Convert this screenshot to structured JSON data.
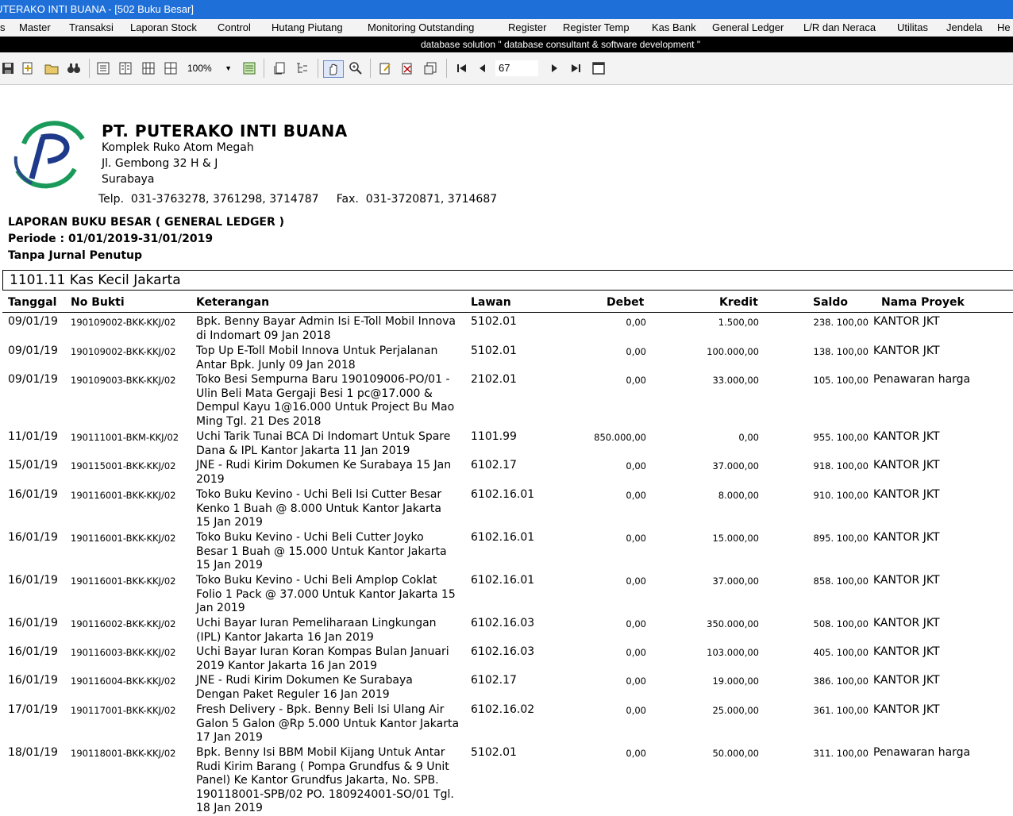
{
  "window": {
    "title": "UTERAKO INTI BUANA - [502 Buku Besar]"
  },
  "menu": [
    "s",
    "Master",
    "Transaksi",
    "Laporan Stock",
    "Control",
    "Hutang Piutang",
    "Monitoring Outstanding",
    "Register",
    "Register Temp",
    "Kas Bank",
    "General Ledger",
    "L/R dan Neraca",
    "Utilitas",
    "Jendela",
    "He"
  ],
  "banner": "database solution  \" database consultant & software development \"",
  "toolbar": {
    "zoom": "100%",
    "page": "67"
  },
  "company": {
    "name": "PT. PUTERAKO INTI BUANA",
    "address": [
      "Komplek Ruko Atom Megah",
      "Jl. Gembong 32 H & J",
      "Surabaya"
    ],
    "phone": "Telp.  031-3763278, 3761298, 3714787     Fax.  031-3720871, 3714687"
  },
  "report": {
    "title": "LAPORAN BUKU BESAR ( GENERAL LEDGER )",
    "period": "Periode : 01/01/2019-31/01/2019",
    "note": "Tanpa Jurnal Penutup",
    "account": "1101.11 Kas Kecil Jakarta"
  },
  "columns": {
    "tanggal": "Tanggal",
    "no_bukti": "No Bukti",
    "keterangan": "Keterangan",
    "lawan": "Lawan",
    "debet": "Debet",
    "kredit": "Kredit",
    "saldo": "Saldo",
    "proyek": "Nama Proyek"
  },
  "rows": [
    {
      "tanggal": "09/01/19",
      "no_bukti": "190109002-BKK-KKJ/02",
      "keterangan": [
        "Bpk. Benny Bayar Admin Isi E-Toll Mobil Innova",
        "di Indomart 09 Jan 2018"
      ],
      "lawan": "5102.01",
      "debet": "0,00",
      "kredit": "1.500,00",
      "saldo": "238. 100,00",
      "proyek": "KANTOR JKT"
    },
    {
      "tanggal": "09/01/19",
      "no_bukti": "190109002-BKK-KKJ/02",
      "keterangan": [
        "Top Up E-Toll Mobil Innova Untuk Perjalanan",
        "Antar Bpk. Junly 09 Jan 2018"
      ],
      "lawan": "5102.01",
      "debet": "0,00",
      "kredit": "100.000,00",
      "saldo": "138. 100,00",
      "proyek": "KANTOR JKT"
    },
    {
      "tanggal": "09/01/19",
      "no_bukti": "190109003-BKK-KKJ/02",
      "keterangan": [
        "Toko Besi Sempurna Baru 190109006-PO/01 -",
        "Ulin Beli Mata Gergaji Besi 1 pc@17.000 &",
        "Dempul Kayu 1@16.000 Untuk Project Bu Mao",
        "Ming Tgl. 21 Des 2018"
      ],
      "lawan": "2102.01",
      "debet": "0,00",
      "kredit": "33.000,00",
      "saldo": "105. 100,00",
      "proyek": "Penawaran harga"
    },
    {
      "tanggal": "11/01/19",
      "no_bukti": "190111001-BKM-KKJ/02",
      "keterangan": [
        "Uchi Tarik Tunai BCA Di Indomart Untuk Spare",
        "Dana & IPL Kantor Jakarta 11 Jan 2019"
      ],
      "lawan": "1101.99",
      "debet": "850.000,00",
      "kredit": "0,00",
      "saldo": "955. 100,00",
      "proyek": "KANTOR JKT"
    },
    {
      "tanggal": "15/01/19",
      "no_bukti": "190115001-BKK-KKJ/02",
      "keterangan": [
        "JNE - Rudi Kirim Dokumen Ke Surabaya 15 Jan",
        "2019"
      ],
      "lawan": "6102.17",
      "debet": "0,00",
      "kredit": "37.000,00",
      "saldo": "918. 100,00",
      "proyek": "KANTOR JKT"
    },
    {
      "tanggal": "16/01/19",
      "no_bukti": "190116001-BKK-KKJ/02",
      "keterangan": [
        "Toko Buku Kevino - Uchi Beli Isi Cutter Besar",
        "Kenko 1 Buah @ 8.000 Untuk Kantor Jakarta",
        "15 Jan 2019"
      ],
      "lawan": "6102.16.01",
      "debet": "0,00",
      "kredit": "8.000,00",
      "saldo": "910. 100,00",
      "proyek": "KANTOR JKT"
    },
    {
      "tanggal": "16/01/19",
      "no_bukti": "190116001-BKK-KKJ/02",
      "keterangan": [
        "Toko Buku Kevino - Uchi Beli Cutter Joyko",
        "Besar 1 Buah @ 15.000 Untuk Kantor Jakarta",
        "15 Jan 2019"
      ],
      "lawan": "6102.16.01",
      "debet": "0,00",
      "kredit": "15.000,00",
      "saldo": "895. 100,00",
      "proyek": "KANTOR JKT"
    },
    {
      "tanggal": "16/01/19",
      "no_bukti": "190116001-BKK-KKJ/02",
      "keterangan": [
        "Toko Buku Kevino - Uchi Beli Amplop Coklat",
        "Folio 1 Pack @ 37.000 Untuk Kantor Jakarta 15",
        "Jan 2019"
      ],
      "lawan": "6102.16.01",
      "debet": "0,00",
      "kredit": "37.000,00",
      "saldo": "858. 100,00",
      "proyek": "KANTOR JKT"
    },
    {
      "tanggal": "16/01/19",
      "no_bukti": "190116002-BKK-KKJ/02",
      "keterangan": [
        "Uchi Bayar Iuran Pemeliharaan Lingkungan",
        "(IPL) Kantor Jakarta 16 Jan 2019"
      ],
      "lawan": "6102.16.03",
      "debet": "0,00",
      "kredit": "350.000,00",
      "saldo": "508. 100,00",
      "proyek": "KANTOR JKT"
    },
    {
      "tanggal": "16/01/19",
      "no_bukti": "190116003-BKK-KKJ/02",
      "keterangan": [
        "Uchi Bayar Iuran Koran Kompas Bulan Januari",
        "2019 Kantor Jakarta 16 Jan 2019"
      ],
      "lawan": "6102.16.03",
      "debet": "0,00",
      "kredit": "103.000,00",
      "saldo": "405. 100,00",
      "proyek": "KANTOR JKT"
    },
    {
      "tanggal": "16/01/19",
      "no_bukti": "190116004-BKK-KKJ/02",
      "keterangan": [
        "JNE - Rudi Kirim Dokumen Ke Surabaya",
        "Dengan Paket Reguler 16 Jan 2019"
      ],
      "lawan": "6102.17",
      "debet": "0,00",
      "kredit": "19.000,00",
      "saldo": "386. 100,00",
      "proyek": "KANTOR JKT"
    },
    {
      "tanggal": "17/01/19",
      "no_bukti": "190117001-BKK-KKJ/02",
      "keterangan": [
        "Fresh Delivery - Bpk. Benny Beli Isi Ulang Air",
        "Galon 5 Galon @Rp 5.000 Untuk Kantor Jakarta",
        "17 Jan 2019"
      ],
      "lawan": "6102.16.02",
      "debet": "0,00",
      "kredit": "25.000,00",
      "saldo": "361. 100,00",
      "proyek": "KANTOR JKT"
    },
    {
      "tanggal": "18/01/19",
      "no_bukti": "190118001-BKK-KKJ/02",
      "keterangan": [
        "Bpk. Benny Isi BBM Mobil Kijang Untuk Antar",
        "Rudi Kirim Barang ( Pompa Grundfus & 9 Unit",
        "Panel) Ke Kantor Grundfus Jakarta, No. SPB.",
        "190118001-SPB/02  PO. 180924001-SO/01 Tgl.",
        "18 Jan 2019"
      ],
      "lawan": "5102.01",
      "debet": "0,00",
      "kredit": "50.000,00",
      "saldo": "311. 100,00",
      "proyek": "Penawaran harga"
    }
  ]
}
